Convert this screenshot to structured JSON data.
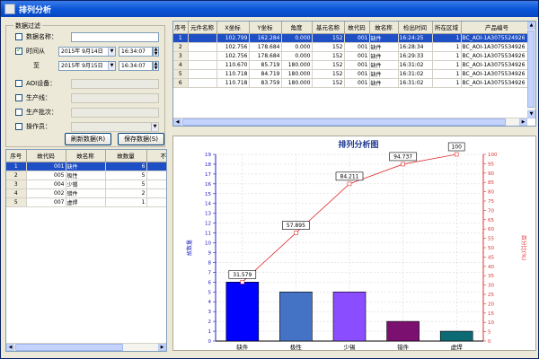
{
  "window": {
    "title": "排列分析"
  },
  "filter": {
    "group_title": "数据过滤",
    "data_name_label": "数据名称：",
    "time_label": "时间从",
    "to_label": "至",
    "from_date": "2015年 9月14日",
    "from_time": "16:34:07",
    "to_date": "2015年 9月15日",
    "to_time": "16:34:07",
    "aoi_label": "AOI设备：",
    "line_label": "生产线：",
    "batch_label": "生产批次：",
    "operator_label": "操作员：",
    "checkbox_time_checked": true
  },
  "buttons": {
    "refresh": "刷新数据(R)",
    "save": "保存数据(S)"
  },
  "top_table": {
    "columns": [
      "序号",
      "元件名称",
      "X坐标",
      "Y坐标",
      "角度",
      "基元名称",
      "故代码",
      "故名称",
      "检出时间",
      "所在区域",
      "产品编号"
    ],
    "rows": [
      [
        "1",
        "",
        "102.799",
        "162.284",
        "0.000",
        "152",
        "001",
        "缺件",
        "16:24:25",
        "1",
        "BC_AOI-1A3075524926"
      ],
      [
        "2",
        "",
        "102.756",
        "178.684",
        "0.000",
        "152",
        "001",
        "缺件",
        "16:28:34",
        "1",
        "BC_AOI-1A3075534926"
      ],
      [
        "3",
        "",
        "102.756",
        "178.684",
        "0.000",
        "152",
        "001",
        "缺件",
        "16:29:33",
        "1",
        "BC_AOI-1A3075534926"
      ],
      [
        "4",
        "",
        "110.670",
        "85.719",
        "180.000",
        "152",
        "001",
        "缺件",
        "16:31:02",
        "1",
        "BC_AOI-1A3075534926"
      ],
      [
        "5",
        "",
        "110.718",
        "84.719",
        "180.000",
        "152",
        "001",
        "缺件",
        "16:31:02",
        "1",
        "BC_AOI-1A3075534926"
      ],
      [
        "6",
        "",
        "110.718",
        "83.759",
        "180.000",
        "152",
        "001",
        "缺件",
        "16:31:02",
        "1",
        "BC_AOI-1A3075534926"
      ]
    ]
  },
  "left_table": {
    "columns": [
      "序号",
      "故代码",
      "故名称",
      "故数量",
      "不良"
    ],
    "rows": [
      [
        "1",
        "001",
        "缺件",
        "6"
      ],
      [
        "2",
        "005",
        "极性",
        "5"
      ],
      [
        "3",
        "004",
        "少锡",
        "5"
      ],
      [
        "4",
        "002",
        "错件",
        "2"
      ],
      [
        "5",
        "007",
        "虚焊",
        "1"
      ]
    ]
  },
  "chart_data": {
    "type": "bar",
    "title": "排列分析图",
    "categories": [
      "缺件",
      "极性",
      "少锡",
      "错件",
      "虚焊"
    ],
    "values": [
      6,
      5,
      5,
      2,
      1
    ],
    "bar_colors": [
      "#0000ff",
      "#4472c4",
      "#8a4dff",
      "#7b1070",
      "#0b6a74"
    ],
    "ylabel": "故数量",
    "ylim": [
      0,
      19
    ],
    "y_ticks": [
      0,
      1,
      2,
      3,
      4,
      5,
      6,
      7,
      8,
      9,
      10,
      11,
      12,
      13,
      14,
      15,
      16,
      17,
      18,
      19
    ],
    "cumulative": {
      "values": [
        31.579,
        57.895,
        84.211,
        94.737,
        100
      ],
      "labels": [
        "31.579",
        "57.895",
        "84.211",
        "94.737",
        "100"
      ],
      "ylabel": "百分比(%)",
      "ylim": [
        0,
        100
      ],
      "y_ticks": [
        0,
        5,
        10,
        15,
        20,
        25,
        30,
        35,
        40,
        45,
        50,
        55,
        60,
        65,
        70,
        75,
        80,
        85,
        90,
        95,
        100
      ],
      "color": "#e03030"
    },
    "grid": true
  }
}
